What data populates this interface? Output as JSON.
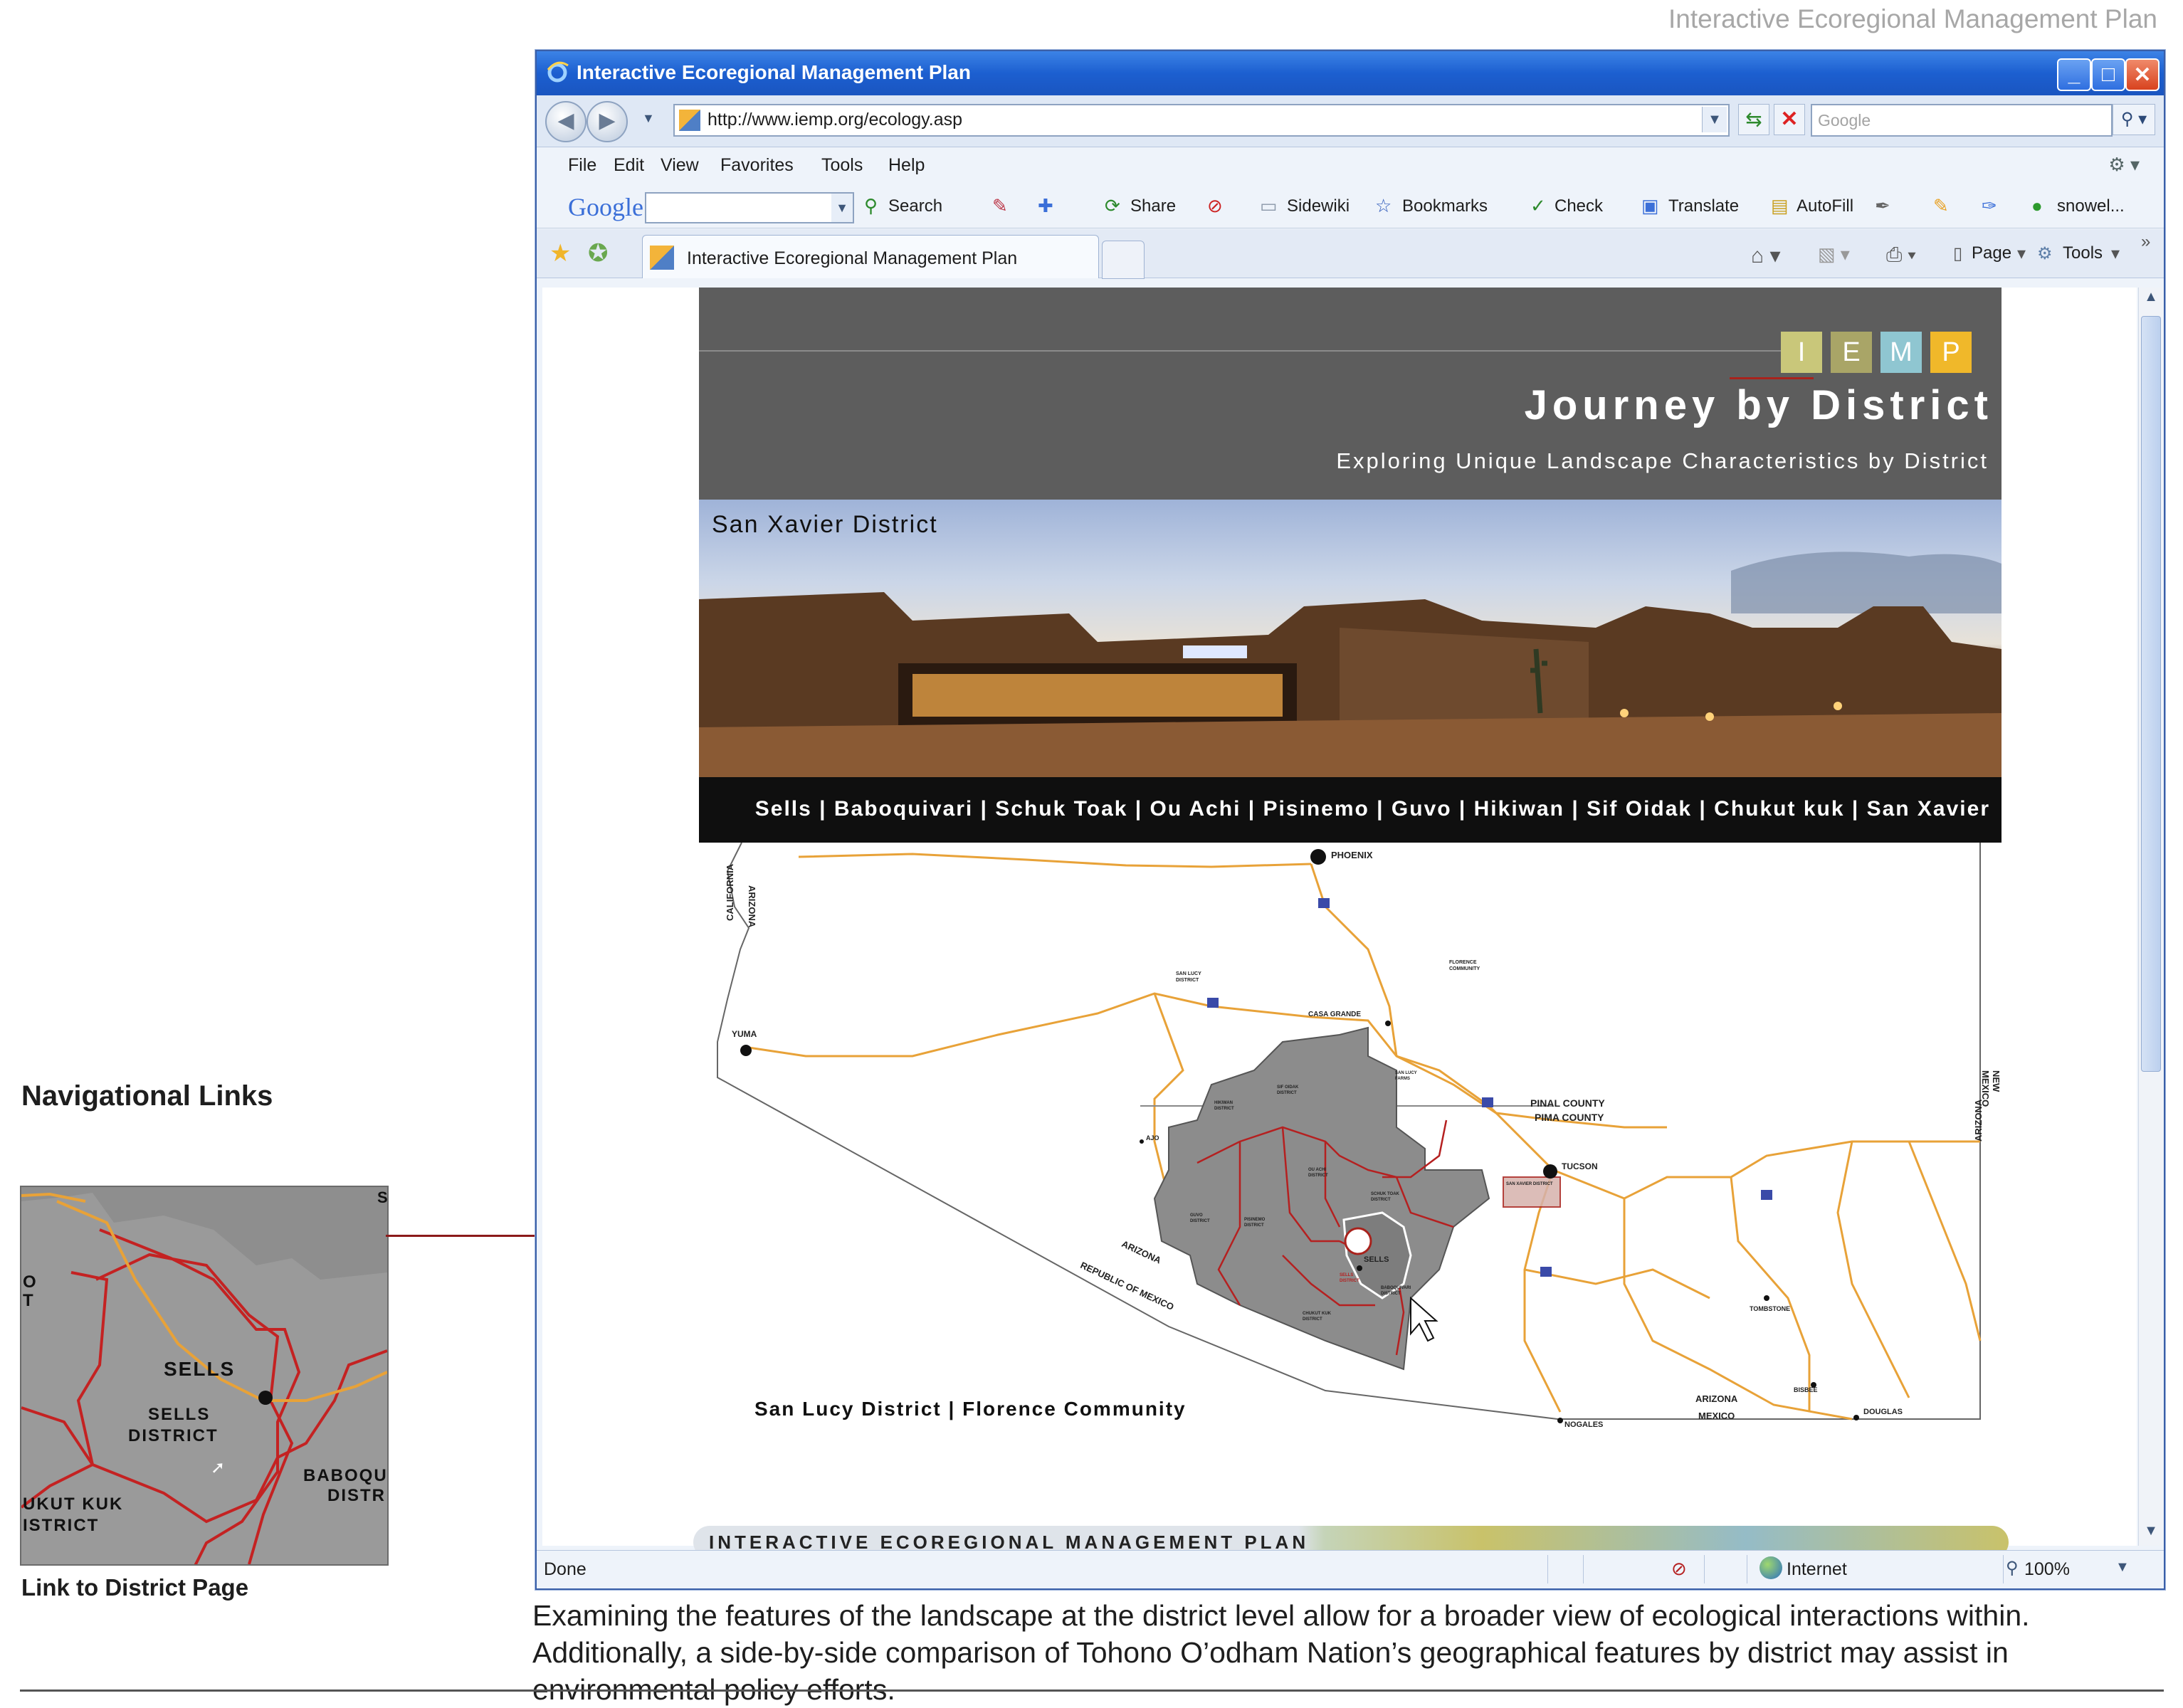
{
  "page": {
    "header_right": "Interactive Ecoregional Management Plan",
    "callout_title": "Navigational Links",
    "inset_caption": "Link to District Page",
    "caption": "Examining the features of the landscape at the district level allow for a broader view of ecological interactions within. Additionally, a side-by-side comparison of Tohono O’odham Nation’s geographical features by district may assist in environmental policy efforts."
  },
  "inset_map": {
    "labels": [
      "SELLS",
      "SELLS",
      "DISTRICT",
      "BABOQU",
      "DISTR",
      "UKUT KUK",
      "ISTRICT",
      "O",
      "T",
      "S"
    ]
  },
  "browser": {
    "title": "Interactive Ecoregional Management Plan",
    "url": "http://www.iemp.org/ecology.asp",
    "search_placeholder": "Google",
    "menu": [
      "File",
      "Edit",
      "View",
      "Favorites",
      "Tools",
      "Help"
    ],
    "google_toolbar": {
      "logo": "Google",
      "search": "Search",
      "share": "Share",
      "sidewiki": "Sidewiki",
      "bookmarks": "Bookmarks",
      "check": "Check",
      "translate": "Translate",
      "autofill": "AutoFill",
      "user": "snowel..."
    },
    "tab_label": "Interactive Ecoregional Management Plan",
    "commands": {
      "page": "Page",
      "tools": "Tools"
    },
    "status": {
      "left": "Done",
      "zone": "Internet",
      "zoom": "100%"
    },
    "icons": [
      "ie-icon",
      "back-icon",
      "forward-icon",
      "refresh-icon",
      "stop-icon",
      "search-icon",
      "favorites-star-icon",
      "add-favorites-icon",
      "home-icon",
      "feeds-icon",
      "print-icon",
      "page-icon",
      "tools-gear-icon",
      "internet-zone-icon",
      "zoom-icon"
    ]
  },
  "site": {
    "logo_letters": [
      {
        "letter": "I",
        "color": "#c9c77a"
      },
      {
        "letter": "E",
        "color": "#a9a567"
      },
      {
        "letter": "M",
        "color": "#8fc6d1"
      },
      {
        "letter": "P",
        "color": "#f0b82a"
      }
    ],
    "title": "Journey by District",
    "subtitle": "Exploring Unique Landscape Characteristics by District",
    "photo_district": "San Xavier District",
    "district_links": "Sells | Baboquivari | Schuk Toak | Ou Achi | Pisinemo | Guvo | Hikiwan | Sif Oidak | Chukut kuk | San Xavier",
    "bottom_links": "San Lucy District | Florence Community",
    "footer_banner": "INTERACTIVE ECOREGIONAL MANAGEMENT PLAN"
  },
  "map": {
    "state_labels": [
      "CALIFORNIA",
      "ARIZONA",
      "NEW MEXICO",
      "ARIZONA",
      "REPUBLIC OF MEXICO",
      "ARIZONA",
      "MEXICO"
    ],
    "cities": [
      "PHOENIX",
      "YUMA",
      "CASA GRANDE",
      "TUCSON",
      "NOGALES",
      "DOUGLAS",
      "TOMBSTONE",
      "BISBEE",
      "AJO",
      "SELLS"
    ],
    "county_labels": [
      "PINAL COUNTY",
      "PIMA COUNTY"
    ],
    "areas": [
      "SAN LUCY DISTRICT",
      "FLORENCE COMMUNITY",
      "SAN LUCY FARMS",
      "HIKIWAN DISTRICT",
      "SIF OIDAK DISTRICT",
      "OU ACHI DISTRICT",
      "SCHUK TOAK DISTRICT",
      "GUVO DISTRICT",
      "PISINEMO DISTRICT",
      "SELLS DISTRICT",
      "BABOQUIVARI DISTRICT",
      "CHUKUT KUK DISTRICT",
      "SAN XAVIER DISTRICT"
    ]
  },
  "colors": {
    "leader_line": "#8b1a1a",
    "roads": "#e8a238",
    "district_fill": "#8c8c8c",
    "hero_gray": "#5d5d5d"
  }
}
